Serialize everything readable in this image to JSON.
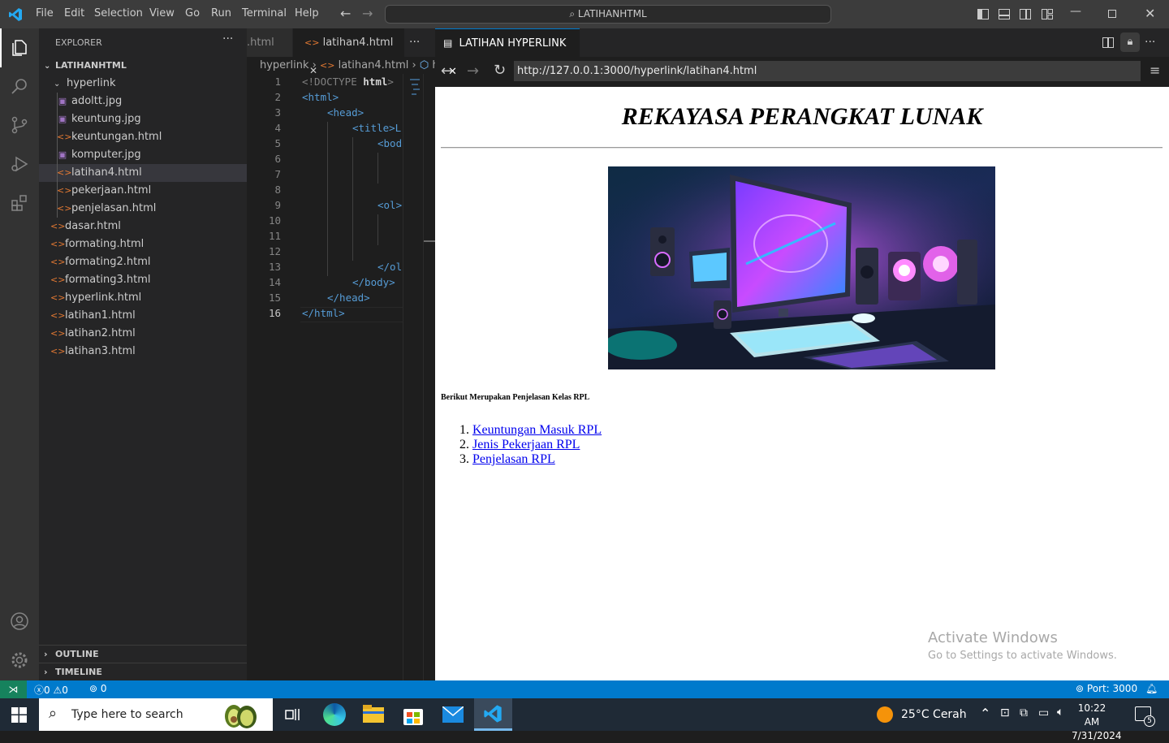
{
  "menu": [
    "File",
    "Edit",
    "Selection",
    "View",
    "Go",
    "Run",
    "Terminal",
    "Help"
  ],
  "command_center": "LATIHANHTML",
  "explorer": {
    "title": "EXPLORER",
    "root": "LATIHANHTML",
    "folder": "hyperlink",
    "folder_files": [
      {
        "name": "adoltt.jpg",
        "type": "img"
      },
      {
        "name": "keuntung.jpg",
        "type": "img"
      },
      {
        "name": "keuntungan.html",
        "type": "html"
      },
      {
        "name": "komputer.jpg",
        "type": "img"
      },
      {
        "name": "latihan4.html",
        "type": "html"
      },
      {
        "name": "pekerjaan.html",
        "type": "html"
      },
      {
        "name": "penjelasan.html",
        "type": "html"
      }
    ],
    "root_files": [
      "dasar.html",
      "formating.html",
      "formating2.html",
      "formating3.html",
      "hyperlink.html",
      "latihan1.html",
      "latihan2.html",
      "latihan3.html"
    ],
    "outline": "OUTLINE",
    "timeline": "TIMELINE"
  },
  "editor": {
    "tab_prev": ".html",
    "tab_active": "latihan4.html",
    "breadcrumb": [
      "hyperlink",
      "latihan4.html",
      "htr"
    ],
    "line_numbers": [
      "1",
      "2",
      "3",
      "4",
      "5",
      "6",
      "7",
      "8",
      "9",
      "10",
      "11",
      "12",
      "13",
      "14",
      "15",
      "16"
    ],
    "code": {
      "l1a": "<!DOCTYPE ",
      "l1b": "html",
      "l1c": ">",
      "l2": "<html>",
      "l3": "<head>",
      "l4": "<title>L",
      "l5": "<bod",
      "l9": "<ol>",
      "l13": "</ol",
      "l14": "</body>",
      "l15": "</head>",
      "l16": "</html>"
    }
  },
  "preview": {
    "tab_title": "LATIHAN HYPERLINK",
    "url": "http://127.0.0.1:3000/hyperlink/latihan4.html",
    "heading": "REKAYASA PERANGKAT LUNAK",
    "description": "Berikut Merupakan Penjelasan Kelas RPL",
    "links": [
      {
        "num": "1.",
        "text": "Keuntungan Masuk RPL"
      },
      {
        "num": "2.",
        "text": "Jenis Pekerjaan RPL"
      },
      {
        "num": "3.",
        "text": "Penjelasan RPL"
      }
    ],
    "watermark_title": "Activate Windows",
    "watermark_sub": "Go to Settings to activate Windows."
  },
  "status": {
    "errors": "0",
    "warnings": "0",
    "ports": "0",
    "port_label": "Port: 3000"
  },
  "taskbar": {
    "search_placeholder": "Type here to search",
    "weather": "25°C  Cerah",
    "time": "10:22 AM",
    "date": "7/31/2024",
    "notifications": "5"
  }
}
